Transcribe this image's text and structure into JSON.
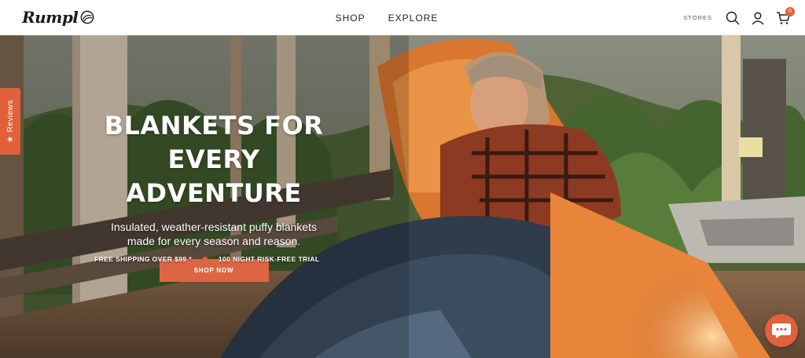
{
  "header": {
    "logo_text": "Rumpl",
    "nav": [
      {
        "label": "SHOP"
      },
      {
        "label": "EXPLORE"
      }
    ],
    "stores_label": "STORES",
    "cart_count": "0",
    "icons": [
      "search-icon",
      "account-icon",
      "cart-icon"
    ]
  },
  "hero": {
    "headline_line1": "BLANKETS FOR",
    "headline_line2": "EVERY ADVENTURE",
    "subtext_line1": "Insulated, weather-resistant puffy blankets",
    "subtext_line2": "made for every season and reason.",
    "cta_label": "SHOP NOW",
    "perks": [
      {
        "label": "FREE SHIPPING OVER $99 *"
      },
      {
        "label": "100 NIGHT RISK-FREE TRIAL"
      }
    ]
  },
  "reviews_tab": {
    "label": "Reviews",
    "icon": "star-icon"
  },
  "chat": {
    "icon": "chat-icon"
  },
  "colors": {
    "accent": "#de6544",
    "header_bg": "#ffffff",
    "text": "#222222"
  }
}
